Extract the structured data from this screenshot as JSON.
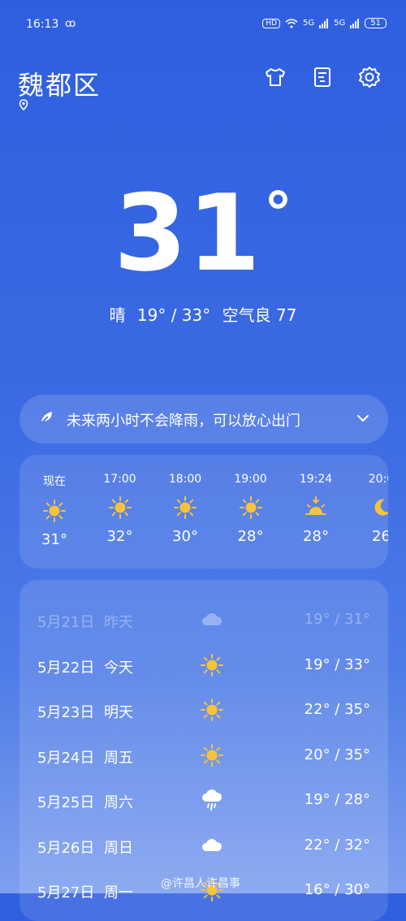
{
  "status_bar": {
    "time": "16:13",
    "weibo": "ꝏ",
    "hd": "HD",
    "signal1": "5G",
    "signal2": "5G",
    "battery": "51"
  },
  "location": {
    "name": "魏都区"
  },
  "current": {
    "temp": "31",
    "degree": "°",
    "summary_weather": "晴",
    "summary_range": "19° / 33°",
    "summary_aqi": "空气良 77"
  },
  "banner": {
    "text": "未来两小时不会降雨，可以放心出门"
  },
  "hourly": [
    {
      "label": "现在",
      "icon": "sun-icon",
      "temp": "31°"
    },
    {
      "label": "17:00",
      "icon": "sun-icon",
      "temp": "32°"
    },
    {
      "label": "18:00",
      "icon": "sun-icon",
      "temp": "30°"
    },
    {
      "label": "19:00",
      "icon": "sun-icon",
      "temp": "28°"
    },
    {
      "label": "19:24",
      "icon": "sunset-icon",
      "temp": "28°"
    },
    {
      "label": "20:0",
      "icon": "moon-icon",
      "temp": "26"
    }
  ],
  "daily": [
    {
      "date": "5月21日",
      "day": "昨天",
      "icon": "cloud-icon",
      "temps": "19° / 31°",
      "past": true
    },
    {
      "date": "5月22日",
      "day": "今天",
      "icon": "sun-icon",
      "temps": "19° / 33°"
    },
    {
      "date": "5月23日",
      "day": "明天",
      "icon": "sun-icon",
      "temps": "22° / 35°"
    },
    {
      "date": "5月24日",
      "day": "周五",
      "icon": "sun-icon",
      "temps": "20° / 35°"
    },
    {
      "date": "5月25日",
      "day": "周六",
      "icon": "rain-icon",
      "temps": "19° / 28°"
    },
    {
      "date": "5月26日",
      "day": "周日",
      "icon": "cloud-icon",
      "temps": "22° / 32°"
    },
    {
      "date": "5月27日",
      "day": "周一",
      "icon": "sun-icon",
      "temps": "16° / 30°"
    }
  ],
  "watermark": "@许昌人许昌事",
  "colors": {
    "sun": "#f7c33a",
    "background_top": "#2f5fe0",
    "background_bottom": "#7ea0ef"
  }
}
